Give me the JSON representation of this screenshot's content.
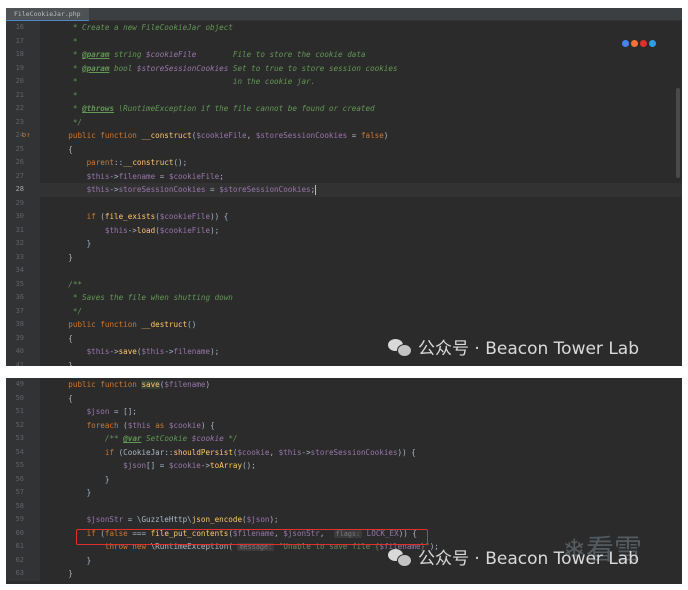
{
  "panel1": {
    "tab_label": "FileCookieJar.php",
    "lines": [
      {
        "n": "16",
        "html": "<span class='cmt'>     * Create a new FileCookieJar object</span>"
      },
      {
        "n": "17",
        "html": "<span class='cmt'>     *</span>"
      },
      {
        "n": "18",
        "html": "<span class='cmt'>     * <span class='dtag'>@param</span> string <span class='var'>$cookieFile</span>        File to store the cookie data</span>"
      },
      {
        "n": "19",
        "html": "<span class='cmt'>     * <span class='dtag'>@param</span> bool <span class='var'>$storeSessionCookies</span> Set to true to store session cookies</span>"
      },
      {
        "n": "20",
        "html": "<span class='cmt'>     *                                  in the cookie jar.</span>"
      },
      {
        "n": "21",
        "html": "<span class='cmt'>     *</span>"
      },
      {
        "n": "22",
        "html": "<span class='cmt'>     * <span class='dtag'>@throws</span> \\RuntimeException if the file cannot be found or created</span>"
      },
      {
        "n": "23",
        "html": "<span class='cmt'>     */</span>"
      },
      {
        "n": "24",
        "html": "    <span class='kw'>public function</span> <span class='fn'>__construct</span>(<span class='var'>$cookieFile</span>, <span class='var'>$storeSessionCookies</span> = <span class='kw'>false</span>)",
        "mark": "o↑"
      },
      {
        "n": "25",
        "html": "    {"
      },
      {
        "n": "26",
        "html": "        <span class='kw'>parent</span>::<span class='fn'>__construct</span>();"
      },
      {
        "n": "27",
        "html": "        <span class='var'>$this</span>-><span class='var'>filename</span> = <span class='var'>$cookieFile</span>;"
      },
      {
        "n": "28",
        "html": "        <span class='var'>$this</span>-><span class='var'>storeSessionCookies</span> = <span class='var'>$storeSessionCookies</span>;<span class='caret'></span>",
        "current": true
      },
      {
        "n": "29",
        "html": ""
      },
      {
        "n": "30",
        "html": "        <span class='kw'>if</span> (<span class='fn'>file_exists</span>(<span class='var'>$cookieFile</span>)) {"
      },
      {
        "n": "31",
        "html": "            <span class='var'>$this</span>-><span class='fn'>load</span>(<span class='var'>$cookieFile</span>);"
      },
      {
        "n": "32",
        "html": "        }"
      },
      {
        "n": "33",
        "html": "    }"
      },
      {
        "n": "34",
        "html": ""
      },
      {
        "n": "35",
        "html": "<span class='cmt'>    /**</span>"
      },
      {
        "n": "36",
        "html": "<span class='cmt'>     * Saves the file when shutting down</span>"
      },
      {
        "n": "37",
        "html": "<span class='cmt'>     */</span>"
      },
      {
        "n": "38",
        "html": "    <span class='kw'>public function</span> <span class='fn'>__destruct</span>()"
      },
      {
        "n": "39",
        "html": "    {"
      },
      {
        "n": "40",
        "html": "        <span class='var'>$this</span>-><span class='fn'>save</span>(<span class='var'>$this</span>-><span class='var'>filename</span>);"
      },
      {
        "n": "41",
        "html": "    }"
      }
    ]
  },
  "panel2": {
    "lines": [
      {
        "n": "49",
        "html": "    <span class='kw'>public function</span> <span class='fn hilite'>save</span>(<span class='var'>$filename</span>)"
      },
      {
        "n": "50",
        "html": "    {"
      },
      {
        "n": "51",
        "html": "        <span class='var'>$json</span> = [];"
      },
      {
        "n": "52",
        "html": "        <span class='kw'>foreach</span> (<span class='var'>$this</span> <span class='kw'>as</span> <span class='var'>$cookie</span>) {"
      },
      {
        "n": "53",
        "html": "            <span class='cmt'>/** <span class='dtag'>@var</span> SetCookie <span class='var'>$cookie</span> */</span>"
      },
      {
        "n": "54",
        "html": "            <span class='kw'>if</span> (CookieJar::<span class='fn'>shouldPersist</span>(<span class='var'>$cookie</span>, <span class='var'>$this</span>-><span class='var'>storeSessionCookies</span>)) {"
      },
      {
        "n": "55",
        "html": "                <span class='var'>$json</span>[] = <span class='var'>$cookie</span>-><span class='fn'>toArray</span>();"
      },
      {
        "n": "56",
        "html": "            }"
      },
      {
        "n": "57",
        "html": "        }"
      },
      {
        "n": "58",
        "html": ""
      },
      {
        "n": "59",
        "html": "        <span class='var'>$jsonStr</span> = \\GuzzleHttp\\<span class='fn'>json_encode</span>(<span class='var'>$json</span>);"
      },
      {
        "n": "60",
        "html": "        <span class='kw'>if</span> (<span class='kw'>false</span> === <span class='fn'>file_put_contents</span>(<span class='var'>$filename</span>, <span class='var'>$jsonStr</span>,  <span class='hint'>flags:</span> <span class='var'>LOCK_EX</span>)) {"
      },
      {
        "n": "61",
        "html": "            <span class='kw'>throw new</span> \\RuntimeException( <span class='hint'>message:</span> <span class='str'>\"Unable to save file {<span class='var'>$filename</span>}\"</span>);"
      },
      {
        "n": "62",
        "html": "        }"
      },
      {
        "n": "63",
        "html": "    }"
      }
    ]
  },
  "watermark_text": "公众号 · Beacon Tower Lab",
  "snow_text": "❄看雪",
  "colors": {
    "editor_bg": "#2b2b2b",
    "gutter_bg": "#313335",
    "highlight_box": "#e0302e"
  }
}
